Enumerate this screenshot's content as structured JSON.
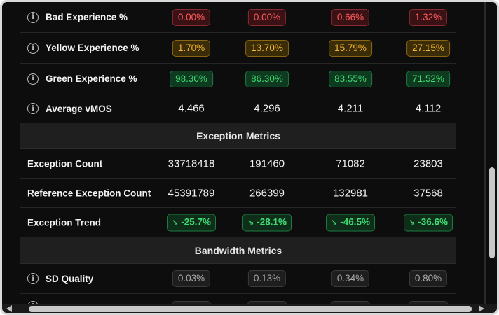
{
  "rows": [
    {
      "label": "Bad Experience %",
      "icon": "info-icon",
      "style": "red",
      "values": [
        "0.00%",
        "0.00%",
        "0.66%",
        "1.32%"
      ]
    },
    {
      "label": "Yellow Experience %",
      "icon": "info-icon",
      "style": "yellow",
      "values": [
        "1.70%",
        "13.70%",
        "15.79%",
        "27.15%"
      ]
    },
    {
      "label": "Green Experience %",
      "icon": "info-icon",
      "style": "green",
      "values": [
        "98.30%",
        "86.30%",
        "83.55%",
        "71.52%"
      ]
    },
    {
      "label": "Average vMOS",
      "icon": "info-icon",
      "style": "plain",
      "values": [
        "4.466",
        "4.296",
        "4.211",
        "4.112"
      ]
    }
  ],
  "sections": {
    "exception": "Exception Metrics",
    "bandwidth": "Bandwidth Metrics"
  },
  "exception_rows": [
    {
      "label": "Exception Count",
      "values": [
        "33718418",
        "191460",
        "71082",
        "23803"
      ]
    },
    {
      "label": "Reference Exception Count",
      "values": [
        "45391789",
        "266399",
        "132981",
        "37568"
      ]
    },
    {
      "label": "Exception Trend",
      "trend_icon": "trend-down-icon",
      "values": [
        "-25.7%",
        "-28.1%",
        "-46.5%",
        "-36.6%"
      ]
    }
  ],
  "bandwidth_rows": [
    {
      "label": "SD Quality",
      "icon": "info-icon",
      "values": [
        "0.03%",
        "0.13%",
        "0.34%",
        "0.80%"
      ]
    }
  ],
  "colors": {
    "background": "#0d0d0d",
    "red": "#ff5a5a",
    "yellow": "#f5b731",
    "green": "#3fdc72",
    "section": "#1f1f1f"
  }
}
